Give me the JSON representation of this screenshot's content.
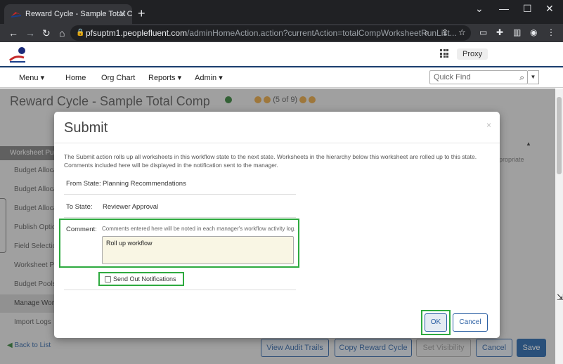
{
  "browser": {
    "tab_title": "Reward Cycle - Sample Total Con",
    "new_tab_label": "+",
    "url_host": "pfsuptm1.peoplefluent.com",
    "url_path": "/adminHomeAction.action?currentAction=totalCompWorksheetRunList..."
  },
  "header": {
    "proxy_label": "Proxy"
  },
  "nav": {
    "items": [
      "Menu ▾",
      "Home",
      "Org Chart",
      "Reports ▾",
      "Admin ▾"
    ],
    "quick_find_placeholder": "Quick Find"
  },
  "page": {
    "title": "Reward Cycle - Sample Total Comp",
    "pager": "(5 of 9)",
    "sidebar_header": "Worksheet Pub",
    "sidebar_items": [
      "Budget Alloca",
      "Budget Alloca",
      "Budget Alloca",
      "Publish Optio",
      "Field Selectio",
      "Worksheet Pa",
      "Budget Pools",
      "Manage Work",
      "Import Logs"
    ],
    "right_fragment": "propriate",
    "back_link": "Back to List",
    "buttons": [
      "View Audit Trails",
      "Copy Reward Cycle",
      "Set Visibility",
      "Cancel",
      "Save"
    ]
  },
  "modal": {
    "title": "Submit",
    "close_label": "×",
    "description": "The Submit action rolls up all worksheets in this workflow state to the next state. Worksheets in the hierarchy below this worksheet are rolled up to this state. Comments included here will be displayed in the notification sent to the manager.",
    "from_state_label": "From State:",
    "from_state_value": "Planning Recommendations",
    "to_state_label": "To State:",
    "to_state_value": "Reviewer Approval",
    "comment_label": "Comment:",
    "comment_hint": "Comments entered here will be noted in each manager's workflow activity log.",
    "comment_value": "Roll up workflow",
    "send_notifications_label": "Send Out Notifications",
    "ok_label": "OK",
    "cancel_label": "Cancel"
  },
  "colors": {
    "highlight": "#2eaa3f",
    "primary": "#1e5fa8",
    "header_rule": "#1a3e6e"
  }
}
